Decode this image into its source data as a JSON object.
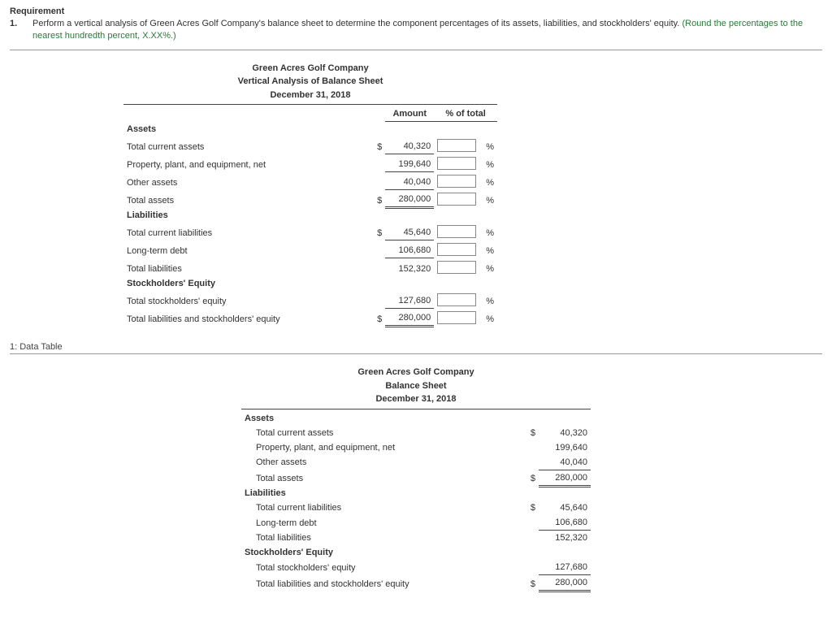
{
  "requirement": {
    "heading": "Requirement",
    "num": "1.",
    "text": "Perform a vertical analysis of Green Acres Golf Company's balance sheet to determine the component percentages of its assets, liabilities, and stockholders' equity. ",
    "hint": "(Round the percentages to the nearest hundredth percent, X.XX%.)"
  },
  "va": {
    "company": "Green Acres Golf Company",
    "title": "Vertical Analysis of Balance Sheet",
    "date": "December 31, 2018",
    "col_amount": "Amount",
    "col_pct": "% of total",
    "pct_sym": "%",
    "dollar": "$",
    "sections": {
      "assets": "Assets",
      "liabilities": "Liabilities",
      "equity": "Stockholders' Equity"
    },
    "rows": {
      "tca": {
        "label": "Total current assets",
        "amount": "40,320"
      },
      "ppe": {
        "label": "Property, plant, and equipment, net",
        "amount": "199,640"
      },
      "oa": {
        "label": "Other assets",
        "amount": "40,040"
      },
      "ta": {
        "label": "Total assets",
        "amount": "280,000"
      },
      "tcl": {
        "label": "Total current liabilities",
        "amount": "45,640"
      },
      "ltd": {
        "label": "Long-term debt",
        "amount": "106,680"
      },
      "tl": {
        "label": "Total liabilities",
        "amount": "152,320"
      },
      "tse": {
        "label": "Total stockholders' equity",
        "amount": "127,680"
      },
      "tlse": {
        "label": "Total liabilities and stockholders' equity",
        "amount": "280,000"
      }
    }
  },
  "data_table_label": "1: Data Table",
  "bs": {
    "company": "Green Acres Golf Company",
    "title": "Balance Sheet",
    "date": "December 31, 2018",
    "dollar": "$",
    "sections": {
      "assets": "Assets",
      "liabilities": "Liabilities",
      "equity": "Stockholders' Equity"
    },
    "rows": {
      "tca": {
        "label": "Total current assets",
        "amount": "40,320"
      },
      "ppe": {
        "label": "Property, plant, and equipment, net",
        "amount": "199,640"
      },
      "oa": {
        "label": "Other assets",
        "amount": "40,040"
      },
      "ta": {
        "label": "Total assets",
        "amount": "280,000"
      },
      "tcl": {
        "label": "Total current liabilities",
        "amount": "45,640"
      },
      "ltd": {
        "label": "Long-term debt",
        "amount": "106,680"
      },
      "tl": {
        "label": "Total liabilities",
        "amount": "152,320"
      },
      "tse": {
        "label": "Total stockholders' equity",
        "amount": "127,680"
      },
      "tlse": {
        "label": "Total liabilities and stockholders' equity",
        "amount": "280,000"
      }
    }
  },
  "chart_data": {
    "type": "table",
    "title": "Green Acres Golf Company — Balance Sheet, December 31, 2018",
    "rows": [
      {
        "section": "Assets",
        "item": "Total current assets",
        "amount": 40320
      },
      {
        "section": "Assets",
        "item": "Property, plant, and equipment, net",
        "amount": 199640
      },
      {
        "section": "Assets",
        "item": "Other assets",
        "amount": 40040
      },
      {
        "section": "Assets",
        "item": "Total assets",
        "amount": 280000
      },
      {
        "section": "Liabilities",
        "item": "Total current liabilities",
        "amount": 45640
      },
      {
        "section": "Liabilities",
        "item": "Long-term debt",
        "amount": 106680
      },
      {
        "section": "Liabilities",
        "item": "Total liabilities",
        "amount": 152320
      },
      {
        "section": "Stockholders' Equity",
        "item": "Total stockholders' equity",
        "amount": 127680
      },
      {
        "section": "Stockholders' Equity",
        "item": "Total liabilities and stockholders' equity",
        "amount": 280000
      }
    ]
  }
}
